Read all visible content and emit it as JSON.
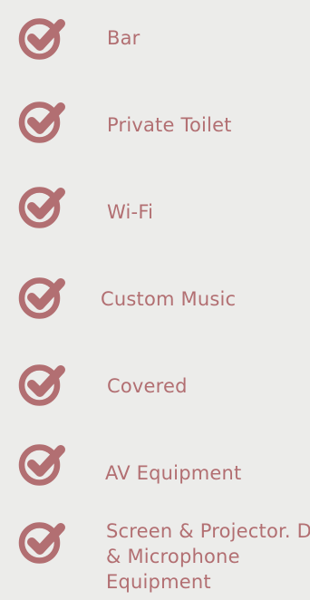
{
  "theme": {
    "accent": "#b26f72",
    "background": "#ececea"
  },
  "amenities": [
    {
      "label": "Bar",
      "icon": "check-circle-icon"
    },
    {
      "label": "Private Toilet",
      "icon": "check-circle-icon"
    },
    {
      "label": "Wi-Fi",
      "icon": "check-circle-icon"
    },
    {
      "label": "Custom Music",
      "icon": "check-circle-icon"
    },
    {
      "label": "Covered",
      "icon": "check-circle-icon"
    },
    {
      "label": "AV Equipment",
      "icon": "check-circle-icon"
    },
    {
      "label": "Screen & Projector. DJ & Microphone Equipment",
      "icon": "check-circle-icon"
    }
  ]
}
